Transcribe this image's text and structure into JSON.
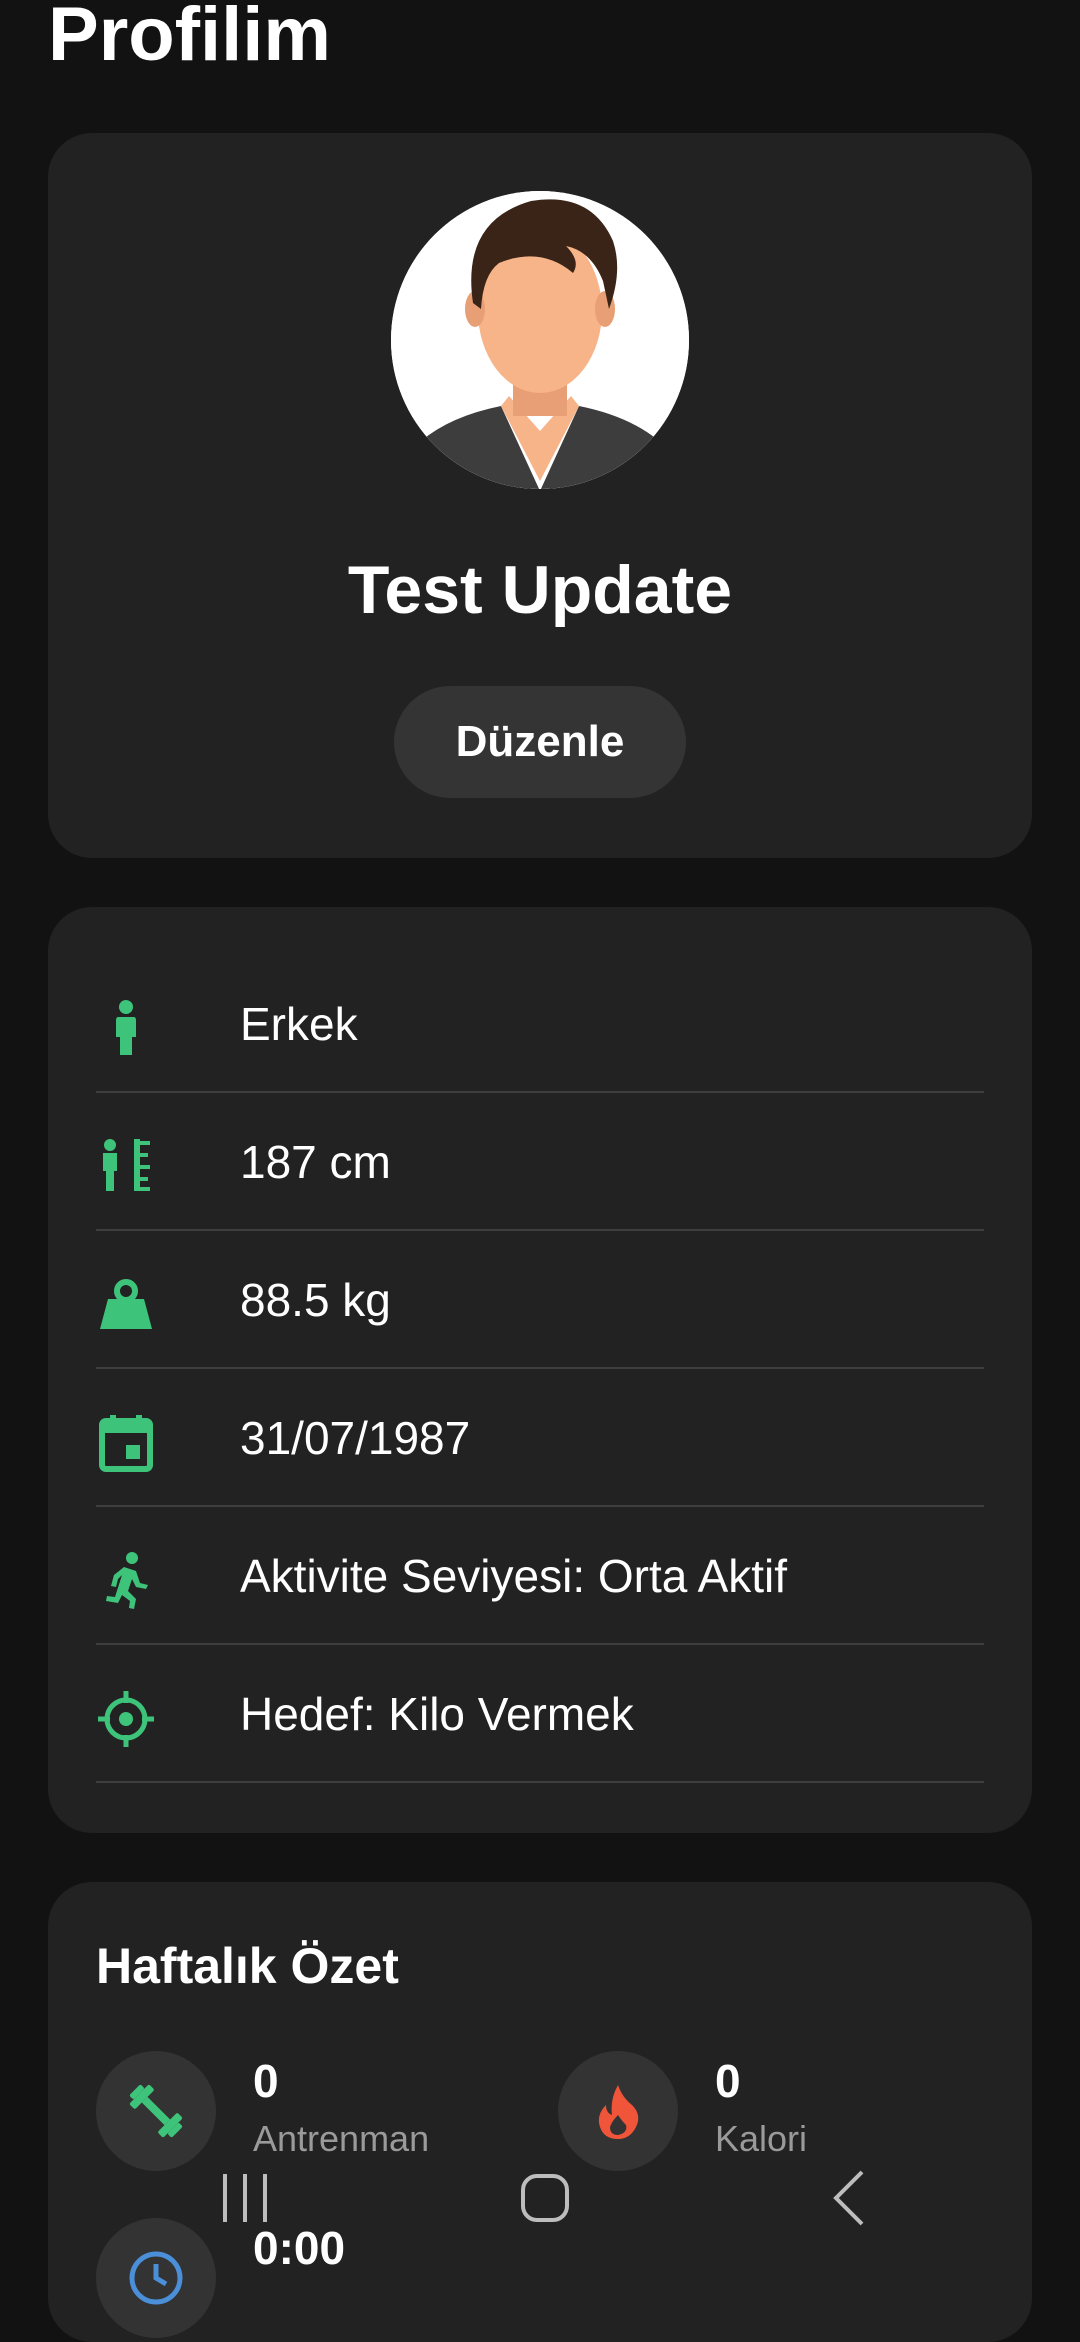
{
  "header": {
    "title": "Profilim"
  },
  "profile": {
    "name": "Test Update",
    "edit_label": "Düzenle",
    "avatar_icon": "male-avatar-icon"
  },
  "info": {
    "accent_color": "#3ec47a",
    "items": [
      {
        "icon": "person-icon",
        "text": "Erkek"
      },
      {
        "icon": "height-icon",
        "text": "187 cm"
      },
      {
        "icon": "weight-icon",
        "text": "88.5 kg"
      },
      {
        "icon": "calendar-icon",
        "text": "31/07/1987"
      },
      {
        "icon": "running-icon",
        "text": "Aktivite Seviyesi: Orta Aktif"
      },
      {
        "icon": "target-icon",
        "text": "Hedef: Kilo Vermek"
      }
    ]
  },
  "summary": {
    "title": "Haftalık Özet",
    "stats": [
      {
        "icon": "dumbbell-icon",
        "color": "#3ec47a",
        "value": "0",
        "label": "Antrenman"
      },
      {
        "icon": "fire-icon",
        "color": "#f0553a",
        "value": "0",
        "label": "Kalori"
      },
      {
        "icon": "clock-icon",
        "color": "#4a8fd8",
        "value": "0:00",
        "label": ""
      }
    ]
  },
  "system_nav": {
    "recents": "recents-icon",
    "home": "home-icon",
    "back": "back-icon"
  }
}
